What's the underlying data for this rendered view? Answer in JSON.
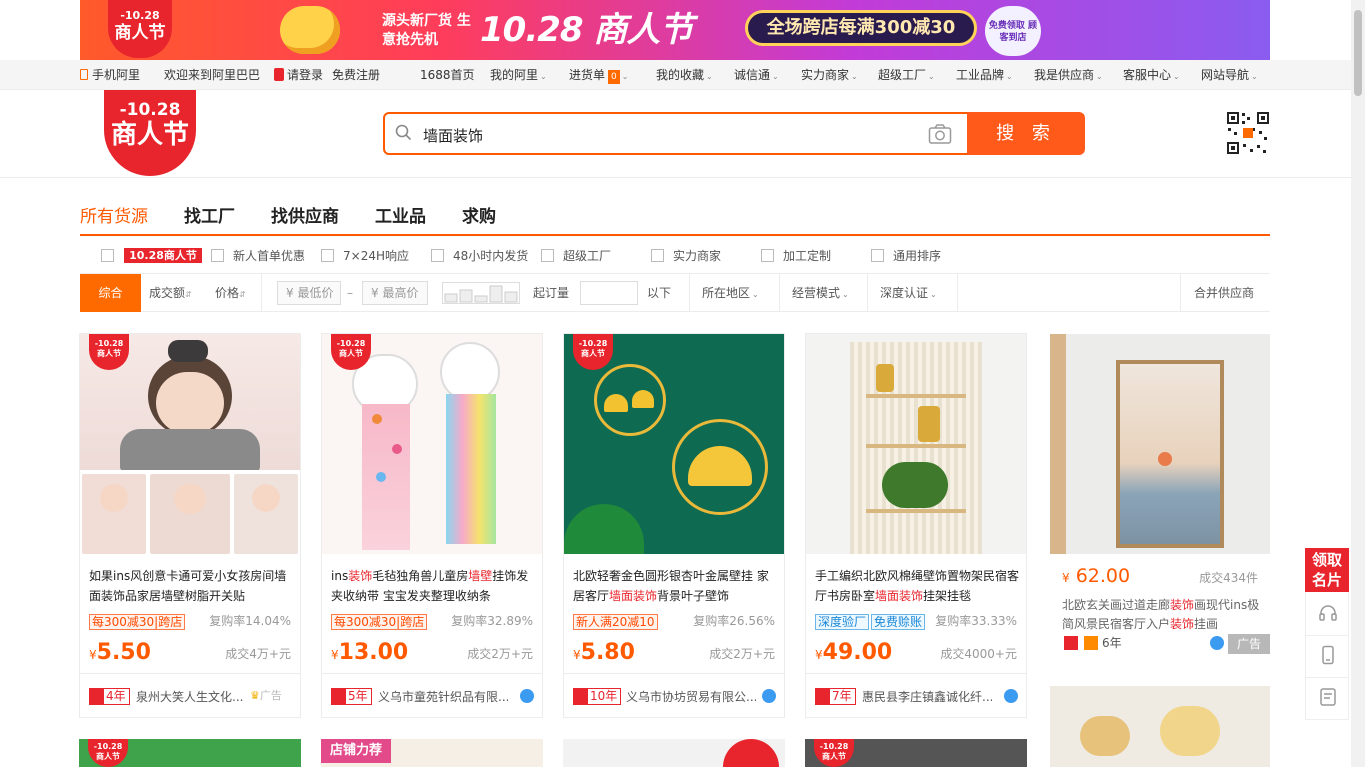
{
  "banner": {
    "badge_top": "-10.28",
    "badge_bottom": "商人节",
    "slogan": "源头新厂货 生意抢先机",
    "festival": "10.28 商人节",
    "offer": "全场跨店每满300减30",
    "coin": "免费领取 顾客到店"
  },
  "topnav": {
    "mobile": "手机阿里",
    "welcome": "欢迎来到阿里巴巴",
    "login": "请登录",
    "register": "免费注册",
    "items": [
      "1688首页",
      "我的阿里",
      "进货单",
      "我的收藏",
      "诚信通",
      "实力商家",
      "超级工厂",
      "工业品牌",
      "我是供应商",
      "客服中心",
      "网站导航"
    ],
    "cart_count": "0"
  },
  "logo": {
    "line1": "-10.28",
    "line2": "商人节"
  },
  "search": {
    "query": "墙面装饰",
    "button": "搜 索"
  },
  "tabs": [
    "所有货源",
    "找工厂",
    "找供应商",
    "工业品",
    "求购"
  ],
  "filters1": {
    "badge": "10.28商人节",
    "options": [
      "新人首单优惠",
      "7×24H响应",
      "48小时内发货",
      "超级工厂",
      "实力商家",
      "加工定制",
      "通用排序"
    ]
  },
  "filters2": {
    "selected": "综合",
    "sort": [
      "成交额",
      "价格"
    ],
    "min_price": "¥ 最低价",
    "dash": "–",
    "max_price": "¥ 最高价",
    "moq": "起订量",
    "below": "以下",
    "region": "所在地区",
    "mode": "经营模式",
    "cert": "深度认证",
    "merge": "合并供应商"
  },
  "products": [
    {
      "title_a": "如果ins风创意卡通可爱小女孩房间墙面装饰品家居墙壁树脂开关贴",
      "tag": "每300减30|跨店",
      "repurchase": "复购率14.04%",
      "price": "5.50",
      "deal": "成交4万+元",
      "years": "4年",
      "company": "泉州大笑人生文化...",
      "ad": "广告"
    },
    {
      "title_a": "ins",
      "title_hl1": "装饰",
      "title_b": "毛毡独角兽儿童房",
      "title_hl2": "墙壁",
      "title_c": "挂饰发夹收纳带 宝宝发夹整理收纳条",
      "tag": "每300减30|跨店",
      "repurchase": "复购率32.89%",
      "price": "13.00",
      "deal": "成交2万+元",
      "years": "5年",
      "company": "义乌市童苑针织品有限..."
    },
    {
      "title_a": "北欧轻奢金色圆形银杏叶金属壁挂 家居客厅",
      "title_hl1": "墙面装饰",
      "title_b": "背景叶子壁饰",
      "tag": "新人满20减10",
      "repurchase": "复购率26.56%",
      "price": "5.80",
      "deal": "成交2万+元",
      "years": "10年",
      "company": "义乌市协坊贸易有限公..."
    },
    {
      "title_a": "手工编织北欧风棉绳壁饰置物架民宿客厅书房卧室",
      "title_hl1": "墙面装饰",
      "title_b": "挂架挂毯",
      "tag1": "深度验厂",
      "tag2": "免费赊账",
      "repurchase": "复购率33.33%",
      "price": "49.00",
      "deal": "成交4000+元",
      "years": "7年",
      "company": "惠民县李庄镇鑫诚化纤..."
    }
  ],
  "ad_product": {
    "price": "62.00",
    "deal": "成交434件",
    "title_a": "北欧玄关画过道走廊",
    "title_hl1": "装饰",
    "title_b": "画现代ins极简风景民宿客厅入户",
    "title_hl2": "装饰",
    "title_c": "挂画",
    "years": "6年",
    "ad": "广告"
  },
  "more_tag": "店铺力荐",
  "side": {
    "top": "领取名片"
  }
}
